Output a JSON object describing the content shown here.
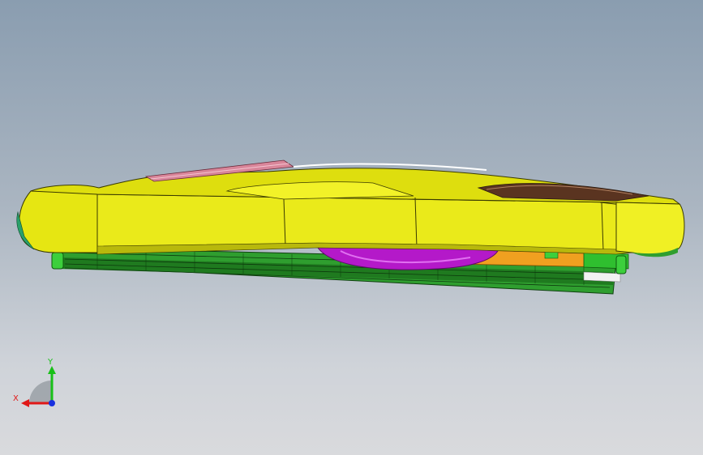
{
  "viewport": {
    "background_top": "#8a9db0",
    "background_bottom": "#d9dadd"
  },
  "model": {
    "parts": [
      "housing-shell",
      "top-trim-strip",
      "circuit-board",
      "motor-dome",
      "bracket",
      "mounting-clips"
    ],
    "colors": {
      "housing": "#eaea1a",
      "housing_dark": "#b8b80c",
      "trim": "#d9869a",
      "board": "#2f9e2f",
      "board_dark": "#1c6b1c",
      "dome": "#b419c9",
      "bracket": "#f0a020",
      "clip": "#3ccf3c"
    }
  },
  "triad": {
    "x_label": "X",
    "y_label": "Y",
    "x_color": "#e01818",
    "y_color": "#18c018",
    "z_color": "#1830e0",
    "icon": "coordinate-triad-icon"
  }
}
